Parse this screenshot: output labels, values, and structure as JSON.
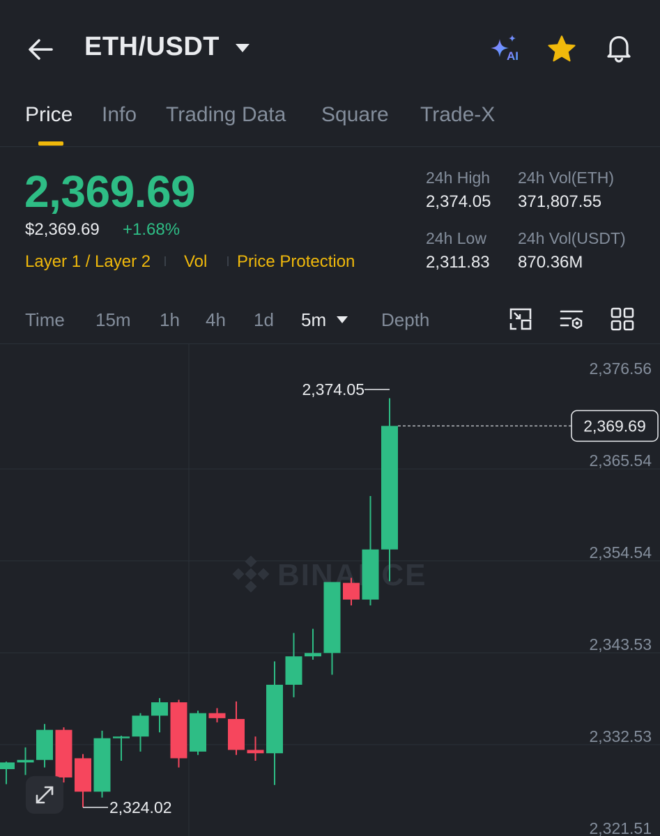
{
  "header": {
    "pair": "ETH/USDT",
    "icons": {
      "back": "arrow-left-icon",
      "pair_dropdown": "caret-down-icon",
      "ai": "ai-sparkle-icon",
      "favorite": "star-icon",
      "alert": "bell-icon"
    },
    "ai_label": "AI"
  },
  "tabs": [
    {
      "label": "Price",
      "active": true
    },
    {
      "label": "Info",
      "active": false
    },
    {
      "label": "Trading Data",
      "active": false
    },
    {
      "label": "Square",
      "active": false
    },
    {
      "label": "Trade-X",
      "active": false
    }
  ],
  "price": {
    "last": "2,369.69",
    "usd": "$2,369.69",
    "change_pct": "+1.68%"
  },
  "tags": [
    "Layer 1 / Layer 2",
    "Vol",
    "Price Protection"
  ],
  "stats": {
    "high_label": "24h High",
    "high_value": "2,374.05",
    "vol_base_label": "24h Vol(ETH)",
    "vol_base_value": "371,807.55",
    "low_label": "24h Low",
    "low_value": "2,311.83",
    "vol_quote_label": "24h Vol(USDT)",
    "vol_quote_value": "870.36M"
  },
  "timeframes": [
    {
      "label": "Time",
      "active": false
    },
    {
      "label": "15m",
      "active": false
    },
    {
      "label": "1h",
      "active": false
    },
    {
      "label": "4h",
      "active": false
    },
    {
      "label": "1d",
      "active": false
    },
    {
      "label": "5m",
      "active": true
    },
    {
      "label": "Depth",
      "active": false
    }
  ],
  "toolbar_icons": [
    "fullscreen-chart-icon",
    "indicator-settings-icon",
    "grid-layout-icon"
  ],
  "colors": {
    "up": "#2ebd85",
    "down": "#f6465d",
    "accent": "#f0b90b",
    "background": "#1f2228",
    "ai_gradient": [
      "#7b61ff",
      "#4aa3ff"
    ]
  },
  "chart_data": {
    "type": "candlestick",
    "interval": "5m",
    "watermark": "BINANCE",
    "y_ticks": [
      "2,376.56",
      "2,365.54",
      "2,354.54",
      "2,343.53",
      "2,332.53",
      "2,321.51"
    ],
    "y_tick_values": [
      2376.56,
      2365.54,
      2354.54,
      2343.53,
      2332.53,
      2321.51
    ],
    "ylim": [
      2321.51,
      2376.56
    ],
    "last_price": 2369.69,
    "last_price_label": "2,369.69",
    "high_marker": {
      "value": 2374.05,
      "label": "2,374.05"
    },
    "low_marker": {
      "value": 2324.02,
      "label": "2,324.02"
    },
    "grid": true,
    "candles": [
      {
        "o": 2328.6,
        "h": 2329.5,
        "l": 2326.8,
        "c": 2329.4
      },
      {
        "o": 2329.4,
        "h": 2331.2,
        "l": 2327.9,
        "c": 2329.7
      },
      {
        "o": 2329.7,
        "h": 2334.0,
        "l": 2328.8,
        "c": 2333.3
      },
      {
        "o": 2333.3,
        "h": 2333.6,
        "l": 2327.0,
        "c": 2327.6
      },
      {
        "o": 2329.9,
        "h": 2330.4,
        "l": 2324.02,
        "c": 2325.9
      },
      {
        "o": 2325.9,
        "h": 2333.2,
        "l": 2325.2,
        "c": 2332.3
      },
      {
        "o": 2332.3,
        "h": 2332.6,
        "l": 2329.6,
        "c": 2332.5
      },
      {
        "o": 2332.5,
        "h": 2335.3,
        "l": 2330.7,
        "c": 2335.0
      },
      {
        "o": 2335.0,
        "h": 2337.1,
        "l": 2333.0,
        "c": 2336.6
      },
      {
        "o": 2336.6,
        "h": 2336.9,
        "l": 2328.8,
        "c": 2329.9
      },
      {
        "o": 2330.7,
        "h": 2335.6,
        "l": 2330.3,
        "c": 2335.3
      },
      {
        "o": 2335.3,
        "h": 2335.9,
        "l": 2334.2,
        "c": 2334.7
      },
      {
        "o": 2334.6,
        "h": 2336.7,
        "l": 2330.3,
        "c": 2330.9
      },
      {
        "o": 2330.9,
        "h": 2332.5,
        "l": 2329.6,
        "c": 2330.5
      },
      {
        "o": 2330.5,
        "h": 2341.5,
        "l": 2326.7,
        "c": 2338.7
      },
      {
        "o": 2338.7,
        "h": 2344.9,
        "l": 2337.2,
        "c": 2342.1
      },
      {
        "o": 2342.1,
        "h": 2345.4,
        "l": 2341.7,
        "c": 2342.5
      },
      {
        "o": 2342.5,
        "h": 2351.0,
        "l": 2339.9,
        "c": 2351.0
      },
      {
        "o": 2350.9,
        "h": 2351.5,
        "l": 2348.2,
        "c": 2348.9
      },
      {
        "o": 2348.9,
        "h": 2361.3,
        "l": 2348.2,
        "c": 2354.9
      },
      {
        "o": 2354.9,
        "h": 2373.0,
        "l": 2351.1,
        "c": 2369.69
      }
    ]
  }
}
